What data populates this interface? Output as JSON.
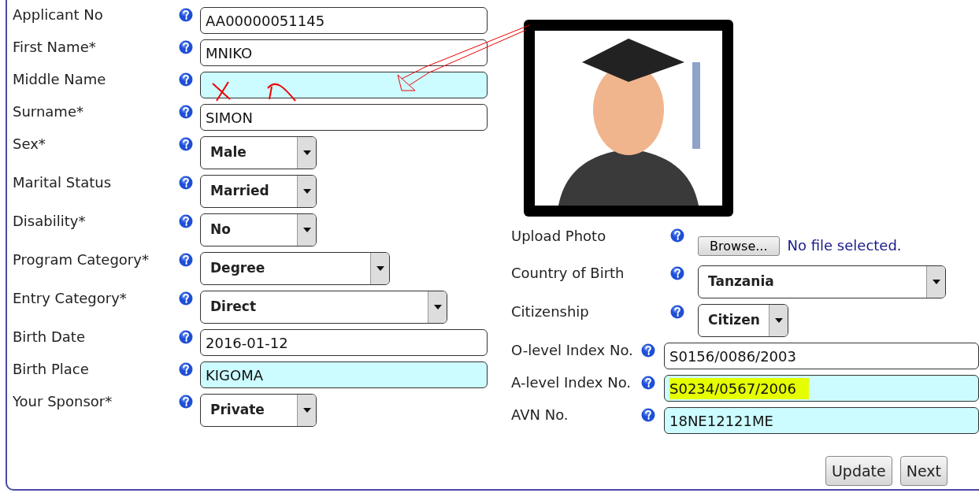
{
  "left_fields": [
    {
      "kind": "text",
      "label": "Applicant No",
      "value": "AA00000051145",
      "tinted": false
    },
    {
      "kind": "text",
      "label": "First Name*",
      "value": "MNIKO",
      "tinted": false
    },
    {
      "kind": "text",
      "label": "Middle Name",
      "tinted": true
    },
    {
      "kind": "text",
      "label": "Surname*",
      "value": "SIMON",
      "tinted": false
    },
    {
      "kind": "select",
      "label": "Sex*",
      "value": "Male",
      "tinted": false
    },
    {
      "kind": "select",
      "label": "Marital Status",
      "value": "Married",
      "tinted": false
    },
    {
      "kind": "select",
      "label": "Disability*",
      "value": "No",
      "tinted": false
    },
    {
      "kind": "select",
      "label": "Program Category*",
      "value": "Degree",
      "tinted": false
    },
    {
      "kind": "select",
      "label": "Entry Category*",
      "value": "Direct",
      "tinted": false
    },
    {
      "kind": "text",
      "label": "Birth Date",
      "value": "2016-01-12",
      "tinted": false
    },
    {
      "kind": "text",
      "label": "Birth Place",
      "value": "KIGOMA",
      "tinted": true
    },
    {
      "kind": "select",
      "label": "Your Sponsor*",
      "value": "Private",
      "tinted": false
    }
  ],
  "upload": {
    "label": "Upload Photo",
    "button": "Browse...",
    "status": "No file selected."
  },
  "right_fields": [
    {
      "kind": "select",
      "label": "Country of Birth",
      "value": "Tanzania",
      "tinted": false
    },
    {
      "kind": "select",
      "label": "Citizenship",
      "value": "Citizen",
      "tinted": false
    },
    {
      "kind": "text",
      "label": "O-level Index No.",
      "value": "S0156/0086/2003",
      "tinted": false
    },
    {
      "kind": "text",
      "label": "A-level Index No.",
      "value": "S0234/0567/2006",
      "tinted": true,
      "marked": true
    },
    {
      "kind": "text",
      "label": "AVN No.",
      "value": "18NE12121ME",
      "tinted": true
    }
  ],
  "buttons": [
    "Update",
    "Next"
  ]
}
